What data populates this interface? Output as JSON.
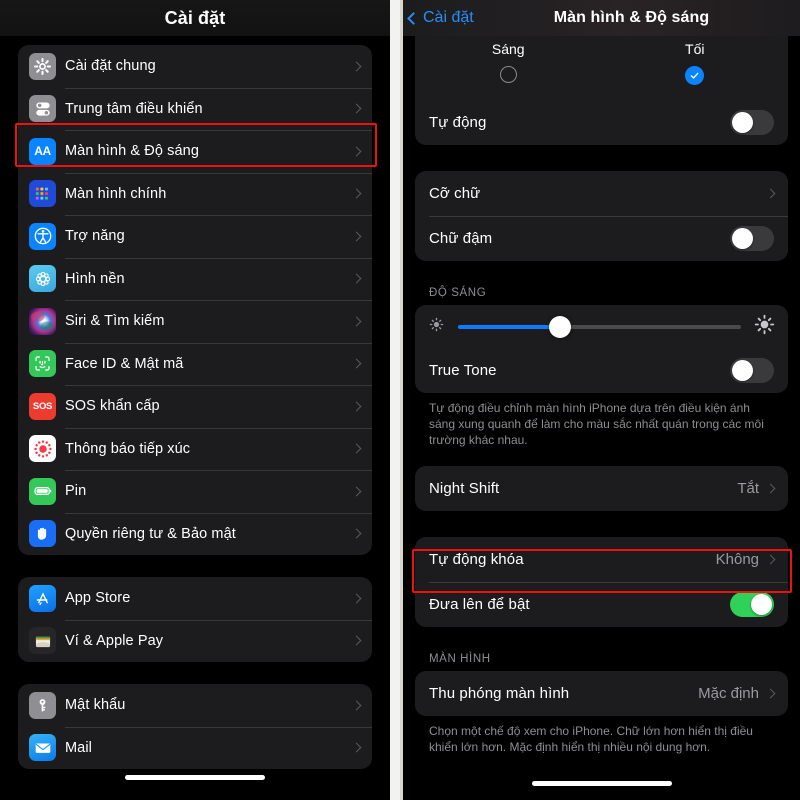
{
  "left_panel": {
    "nav_title": "Cài đặt",
    "groups": [
      {
        "id": "group-system",
        "items": [
          {
            "label": "Cài đặt chung",
            "icon": "gear-icon",
            "icon_bg": "#8e8e93"
          },
          {
            "label": "Trung tâm điều khiển",
            "icon": "control-center-icon",
            "icon_bg": "#8e8e93"
          },
          {
            "label": "Màn hình & Độ sáng",
            "icon": "display-aa-icon",
            "icon_bg": "#0a84ff",
            "highlighted": true
          },
          {
            "label": "Màn hình chính",
            "icon": "home-screen-icon",
            "icon_bg": "#1f4bd8"
          },
          {
            "label": "Trợ năng",
            "icon": "accessibility-icon",
            "icon_bg": "#0a84ff"
          },
          {
            "label": "Hình nền",
            "icon": "wallpaper-icon",
            "icon_bg": "#4ab5e8"
          },
          {
            "label": "Siri & Tìm kiếm",
            "icon": "siri-icon",
            "icon_bg": "#1a1a2e"
          },
          {
            "label": "Face ID & Mật mã",
            "icon": "faceid-icon",
            "icon_bg": "#34c759"
          },
          {
            "label": "SOS khẩn cấp",
            "icon": "sos-icon",
            "icon_bg": "#ee3b30"
          },
          {
            "label": "Thông báo tiếp xúc",
            "icon": "exposure-icon",
            "icon_bg": "#ffffff"
          },
          {
            "label": "Pin",
            "icon": "battery-icon",
            "icon_bg": "#34c759"
          },
          {
            "label": "Quyền riêng tư & Bảo mật",
            "icon": "privacy-hand-icon",
            "icon_bg": "#1a6ef5"
          }
        ]
      },
      {
        "id": "group-store",
        "items": [
          {
            "label": "App Store",
            "icon": "app-store-icon",
            "icon_bg": "#0a84ff"
          },
          {
            "label": "Ví & Apple Pay",
            "icon": "wallet-icon",
            "icon_bg": "#2a2a2c"
          }
        ]
      },
      {
        "id": "group-accounts",
        "items": [
          {
            "label": "Mật khẩu",
            "icon": "key-icon",
            "icon_bg": "#8e8e93"
          },
          {
            "label": "Mail",
            "icon": "mail-icon",
            "icon_bg": "#1a9ef5"
          }
        ]
      }
    ]
  },
  "right_panel": {
    "back_label": "Cài đặt",
    "nav_title": "Màn hình & Độ sáng",
    "appearance": {
      "light_label": "Sáng",
      "dark_label": "Tối",
      "selected": "Tối"
    },
    "automatic_row": {
      "label": "Tự động",
      "toggle": "off"
    },
    "text_group": [
      {
        "label": "Cỡ chữ",
        "type": "disclosure",
        "value": ""
      },
      {
        "label": "Chữ đậm",
        "type": "toggle",
        "toggle": "off"
      }
    ],
    "brightness": {
      "section_header": "ĐỘ SÁNG",
      "slider_percent": 36,
      "true_tone_label": "True Tone",
      "true_tone_toggle": "off",
      "footer": "Tự động điều chỉnh màn hình iPhone dựa trên điều kiện ánh sáng xung quanh để làm cho màu sắc nhất quán trong các môi trường khác nhau."
    },
    "night_shift": {
      "label": "Night Shift",
      "value": "Tắt"
    },
    "lock_group": {
      "auto_lock": {
        "label": "Tự động khóa",
        "value": "Không",
        "highlighted": true
      },
      "raise_to_wake": {
        "label": "Đưa lên để bật",
        "toggle": "on"
      }
    },
    "display_section": {
      "section_header": "MÀN HÌNH",
      "zoom_row": {
        "label": "Thu phóng màn hình",
        "value": "Mặc định"
      },
      "footer": "Chọn một chế độ xem cho iPhone. Chữ lớn hơn hiển thị điều khiển lớn hơn. Mặc định hiển thị nhiều nội dung hơn."
    }
  },
  "colors": {
    "accent_blue": "#0a84ff",
    "toggle_on_green": "#30d158",
    "highlight_red": "#ee1111",
    "row_bg": "#1c1c1e",
    "secondary_text": "#8e8e93"
  }
}
